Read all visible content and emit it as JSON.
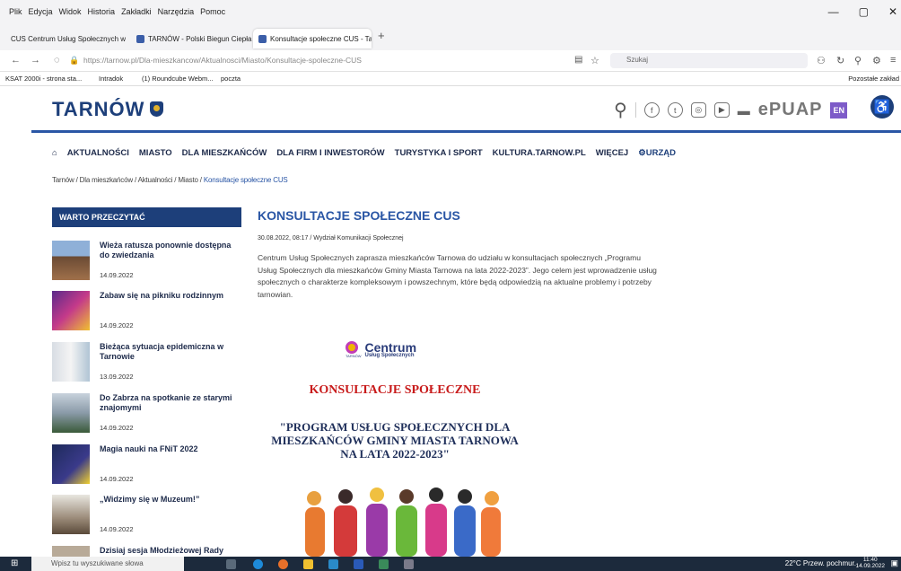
{
  "browser": {
    "menu": [
      "Plik",
      "Edycja",
      "Widok",
      "Historia",
      "Zakładki",
      "Narzędzia",
      "Pomoc"
    ],
    "window_controls": [
      "—",
      "▢",
      "✕"
    ],
    "tabs": [
      {
        "label": "CUS Centrum Usług Społecznych w",
        "active": false
      },
      {
        "label": "TARNÓW - Polski Biegun Ciepła",
        "active": false
      },
      {
        "label": "Konsultacje społeczne CUS - Ta",
        "active": true
      }
    ],
    "url": "https://tarnow.pl/Dla-mieszkancow/Aktualnosci/Miasto/Konsultacje-spoleczne-CUS",
    "search_placeholder": "Szukaj",
    "bookmarks": [
      "KSAT 2000i - strona sta...",
      "Intradok",
      "(1) Roundcube Webm...",
      "poczta"
    ],
    "other_bookmarks": "Pozostałe zakład"
  },
  "site": {
    "logo": "TARNÓW",
    "epuap": "ePUAP",
    "lang": "EN",
    "nav": [
      "AKTUALNOŚCI",
      "MIASTO",
      "DLA MIESZKAŃCÓW",
      "DLA FIRM I INWESTORÓW",
      "TURYSTYKA I SPORT",
      "KULTURA.TARNOW.PL",
      "WIĘCEJ",
      "URZĄD"
    ],
    "breadcrumb": [
      "Tarnów",
      "Dla mieszkańców",
      "Aktualności",
      "Miasto",
      "Konsultacje społeczne CUS"
    ]
  },
  "sidebar": {
    "heading": "WARTO PRZECZYTAĆ",
    "items": [
      {
        "title": "Wieża ratusza ponownie dostępna do zwiedzania",
        "date": "14.09.2022"
      },
      {
        "title": "Zabaw się na pikniku rodzinnym",
        "date": "14.09.2022"
      },
      {
        "title": "Bieżąca sytuacja epidemiczna w Tarnowie",
        "date": "13.09.2022"
      },
      {
        "title": "Do Zabrza na spotkanie ze starymi znajomymi",
        "date": "14.09.2022"
      },
      {
        "title": "Magia nauki na FNiT 2022",
        "date": "14.09.2022"
      },
      {
        "title": "„Widzimy się w Muzeum!”",
        "date": "14.09.2022"
      },
      {
        "title": "Dzisiaj sesja Młodzieżowej Rady",
        "date": ""
      }
    ]
  },
  "article": {
    "title": "KONSULTACJE SPOŁECZNE CUS",
    "date": "30.08.2022, 08:17",
    "author": "/ Wydział Komunikacji Społecznej",
    "body": "Centrum Usług Społecznych zaprasza mieszkańców Tarnowa do udziału w konsultacjach społecznych „Programu Usług Społecznych dla mieszkańców Gminy Miasta Tarnowa na lata 2022-2023”. Jego celem jest wprowadzenie usług społecznych o charakterze kompleksowym i powszechnym, które będą odpowiedzią na aktualne problemy i potrzeby tarnowian.",
    "poster": {
      "logo_name": "Centrum",
      "logo_sub": "Usług Społecznych",
      "logo_city": "TARNÓW",
      "heading": "KONSULTACJE SPOŁECZNE",
      "program": "\"PROGRAM USŁUG SPOŁECZNYCH DLA MIESZKAŃCÓW GMINY MIASTA TARNOWA NA LATA 2022-2023\""
    }
  },
  "taskbar": {
    "search_placeholder": "Wpisz tu wyszukiwane słowa",
    "weather": "22°C  Przew. pochmur.",
    "time": "11:40",
    "date": "14.09.2022"
  },
  "colors": {
    "brand": "#1d3f7a",
    "accent": "#2a56a5",
    "poster_red": "#c81b1b"
  }
}
